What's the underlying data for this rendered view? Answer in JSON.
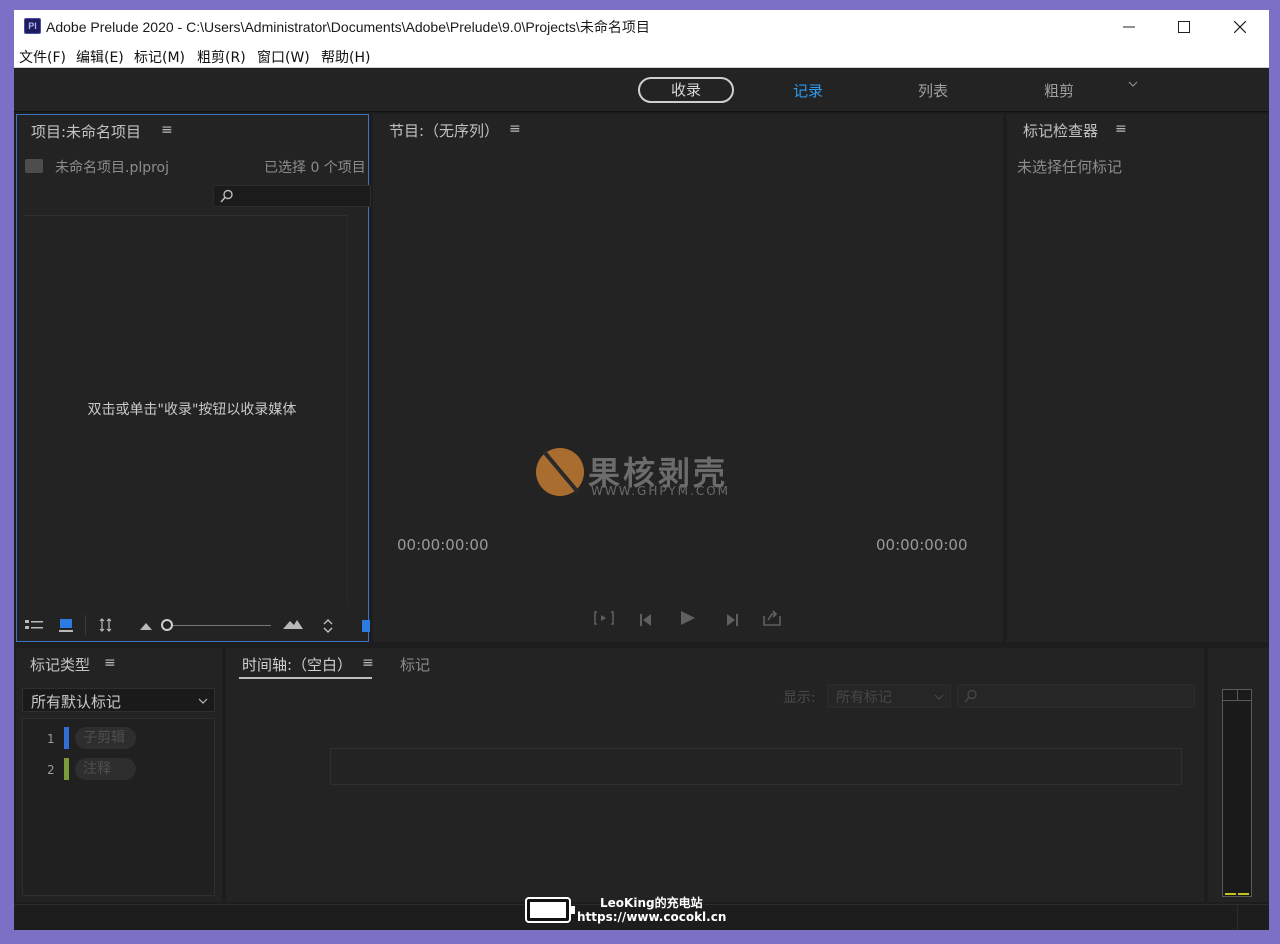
{
  "window": {
    "title": "Adobe Prelude 2020 - C:\\Users\\Administrator\\Documents\\Adobe\\Prelude\\9.0\\Projects\\未命名项目",
    "app_icon": "Pl"
  },
  "menu": [
    "文件(F)",
    "编辑(E)",
    "标记(M)",
    "粗剪(R)",
    "窗口(W)",
    "帮助(H)"
  ],
  "workspaces": {
    "ingest": "收录",
    "tabs": [
      "记录",
      "列表",
      "粗剪"
    ],
    "active_tab": "记录",
    "accent_color": "#2d9bf0"
  },
  "project_panel": {
    "title": "项目:未命名项目",
    "file_name": "未命名项目.plproj",
    "selected_count": "已选择 0 个项目",
    "empty_hint": "双击或单击\"收录\"按钮以收录媒体"
  },
  "program_panel": {
    "title": "节目:（无序列）",
    "timecode_left": "00:00:00:00",
    "timecode_right": "00:00:00:00"
  },
  "inspector_panel": {
    "title": "标记检查器",
    "empty_text": "未选择任何标记"
  },
  "marker_type_panel": {
    "title": "标记类型",
    "dropdown_value": "所有默认标记",
    "items": [
      {
        "num": "1",
        "label": "子剪辑",
        "color": "#2f6fd6"
      },
      {
        "num": "2",
        "label": "注释",
        "color": "#7d9a3a"
      }
    ]
  },
  "timeline_panel": {
    "tab_active": "时间轴:（空白）",
    "tab_other": "标记",
    "show_label": "显示:",
    "show_value": "所有标记"
  },
  "watermark": {
    "text_cn": "果核剥壳",
    "url": "WWW.GHPYM.COM"
  },
  "overlay": {
    "name": "LeoKing的充电站",
    "url": "https://www.cocokl.cn"
  }
}
